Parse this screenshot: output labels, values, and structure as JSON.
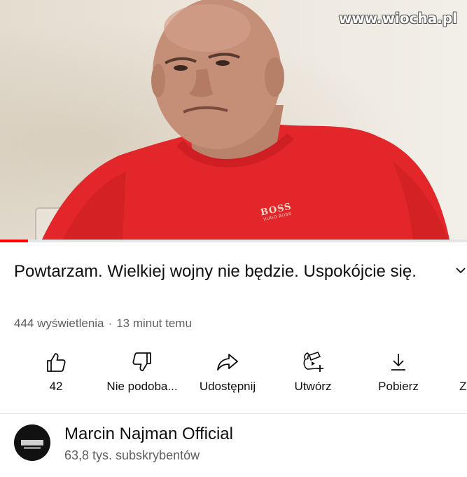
{
  "watermark": "www.wiocha.pl",
  "video": {
    "shirt_brand": "BOSS",
    "shirt_brand_sub": "HUGO BOSS",
    "progress_fraction": 0.06,
    "colors": {
      "progress": "#ff0000",
      "shirt": "#e3262a"
    }
  },
  "title": "Powtarzam. Wielkiej wojny nie będzie. Uspokójcie się.",
  "meta": {
    "views": "444 wyświetlenia",
    "separator": "·",
    "time": "13 minut temu"
  },
  "actions": [
    {
      "icon": "thumbs-up-icon",
      "label": "42"
    },
    {
      "icon": "thumbs-down-icon",
      "label": "Nie podoba..."
    },
    {
      "icon": "share-icon",
      "label": "Udostępnij"
    },
    {
      "icon": "create-icon",
      "label": "Utwórz"
    },
    {
      "icon": "download-icon",
      "label": "Pobierz"
    },
    {
      "icon": "more-icon",
      "label": "Z"
    }
  ],
  "channel": {
    "name": "Marcin Najman Official",
    "subscribers": "63,8 tys. subskrybentów"
  }
}
